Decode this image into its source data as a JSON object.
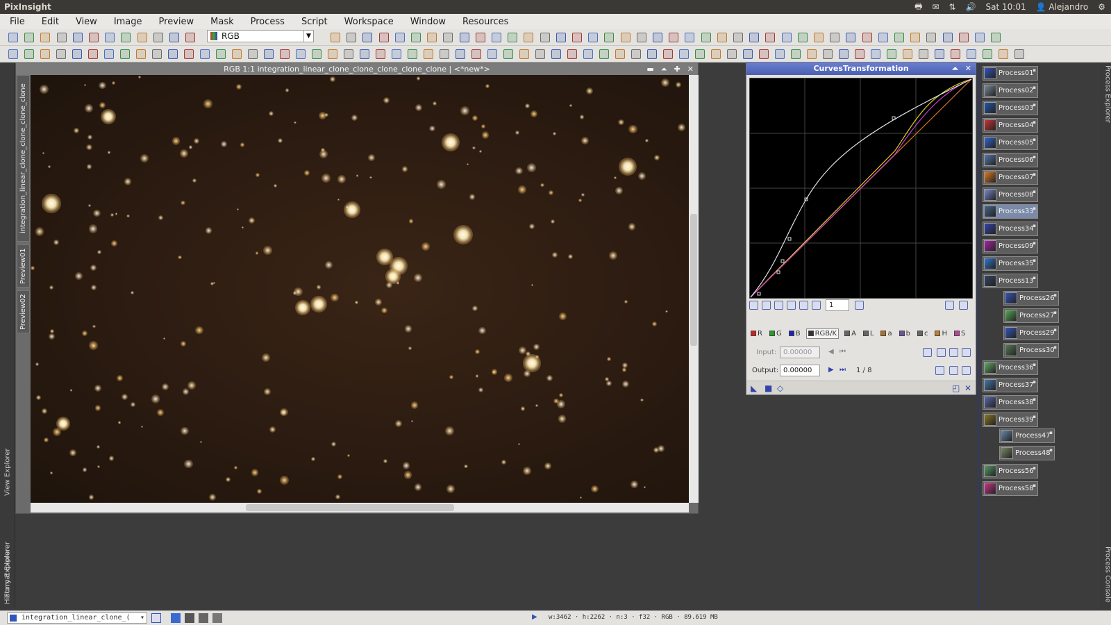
{
  "app": {
    "title": "PixInsight"
  },
  "tray": {
    "time": "Sat 10:01",
    "user": "Alejandro"
  },
  "menu": [
    "File",
    "Edit",
    "View",
    "Image",
    "Preview",
    "Mask",
    "Process",
    "Script",
    "Workspace",
    "Window",
    "Resources"
  ],
  "toolbar": {
    "rgb_combo": "RGB"
  },
  "image_window": {
    "title": "RGB 1:1 integration_linear_clone_clone_clone_clone_clone | <*new*>",
    "side_title": "integration_linear_clone_clone_clone_clone",
    "preview_tabs": [
      "Preview01",
      "Preview02"
    ]
  },
  "curves": {
    "title": "CurvesTransformation",
    "zoom": "1",
    "channels": [
      {
        "label": "R",
        "color": "#d02020"
      },
      {
        "label": "G",
        "color": "#20a020"
      },
      {
        "label": "B",
        "color": "#2020c0"
      },
      {
        "label": "RGB/K",
        "color": "#333333"
      },
      {
        "label": "A",
        "color": "#666666"
      },
      {
        "label": "L",
        "color": "#666666"
      },
      {
        "label": "a",
        "color": "#b07020"
      },
      {
        "label": "b",
        "color": "#7050a0"
      },
      {
        "label": "c",
        "color": "#666666"
      },
      {
        "label": "H",
        "color": "#c08030"
      },
      {
        "label": "S",
        "color": "#c040a0"
      }
    ],
    "input_label": "Input:",
    "input_value": "0.00000",
    "output_label": "Output:",
    "output_value": "0.00000",
    "point_index": "1 / 8"
  },
  "left_explorers": [
    "View Explorer",
    "Format Explorer",
    "History Explorer"
  ],
  "right_explorers": [
    "Process Explorer",
    "Process Console"
  ],
  "processes": [
    {
      "label": "Process01",
      "color": "#3355bb"
    },
    {
      "label": "Process02",
      "color": "#778899"
    },
    {
      "label": "Process03",
      "color": "#2255aa"
    },
    {
      "label": "Process04",
      "color": "#cc3333"
    },
    {
      "label": "Process05",
      "color": "#3366cc"
    },
    {
      "label": "Process06",
      "color": "#5577aa"
    },
    {
      "label": "Process07",
      "color": "#dd7722"
    },
    {
      "label": "Process08",
      "color": "#7788cc"
    },
    {
      "label": "Process33",
      "color": "#446688"
    },
    {
      "label": "Process34",
      "color": "#3344aa"
    },
    {
      "label": "Process09",
      "color": "#aa22aa"
    },
    {
      "label": "Process35",
      "color": "#3377cc"
    },
    {
      "label": "Process13",
      "color": "#334466"
    },
    {
      "label": "Process26",
      "color": "#3355bb"
    },
    {
      "label": "Process27",
      "color": "#55aa55"
    },
    {
      "label": "Process29",
      "color": "#3355bb"
    },
    {
      "label": "Process30",
      "color": "#557755"
    },
    {
      "label": "Process36",
      "color": "#66aa66"
    },
    {
      "label": "Process37",
      "color": "#4477aa"
    },
    {
      "label": "Process38",
      "color": "#5566aa"
    },
    {
      "label": "Process39",
      "color": "#887722"
    },
    {
      "label": "Process47",
      "color": "#6688aa"
    },
    {
      "label": "Process48",
      "color": "#778866"
    },
    {
      "label": "Process56",
      "color": "#559966"
    },
    {
      "label": "Process58",
      "color": "#cc3388"
    }
  ],
  "status": {
    "view": "integration_linear_clone_(",
    "info": "w:3462 · h:2262 · n:3 · f32 · RGB · 89.619 MB"
  }
}
